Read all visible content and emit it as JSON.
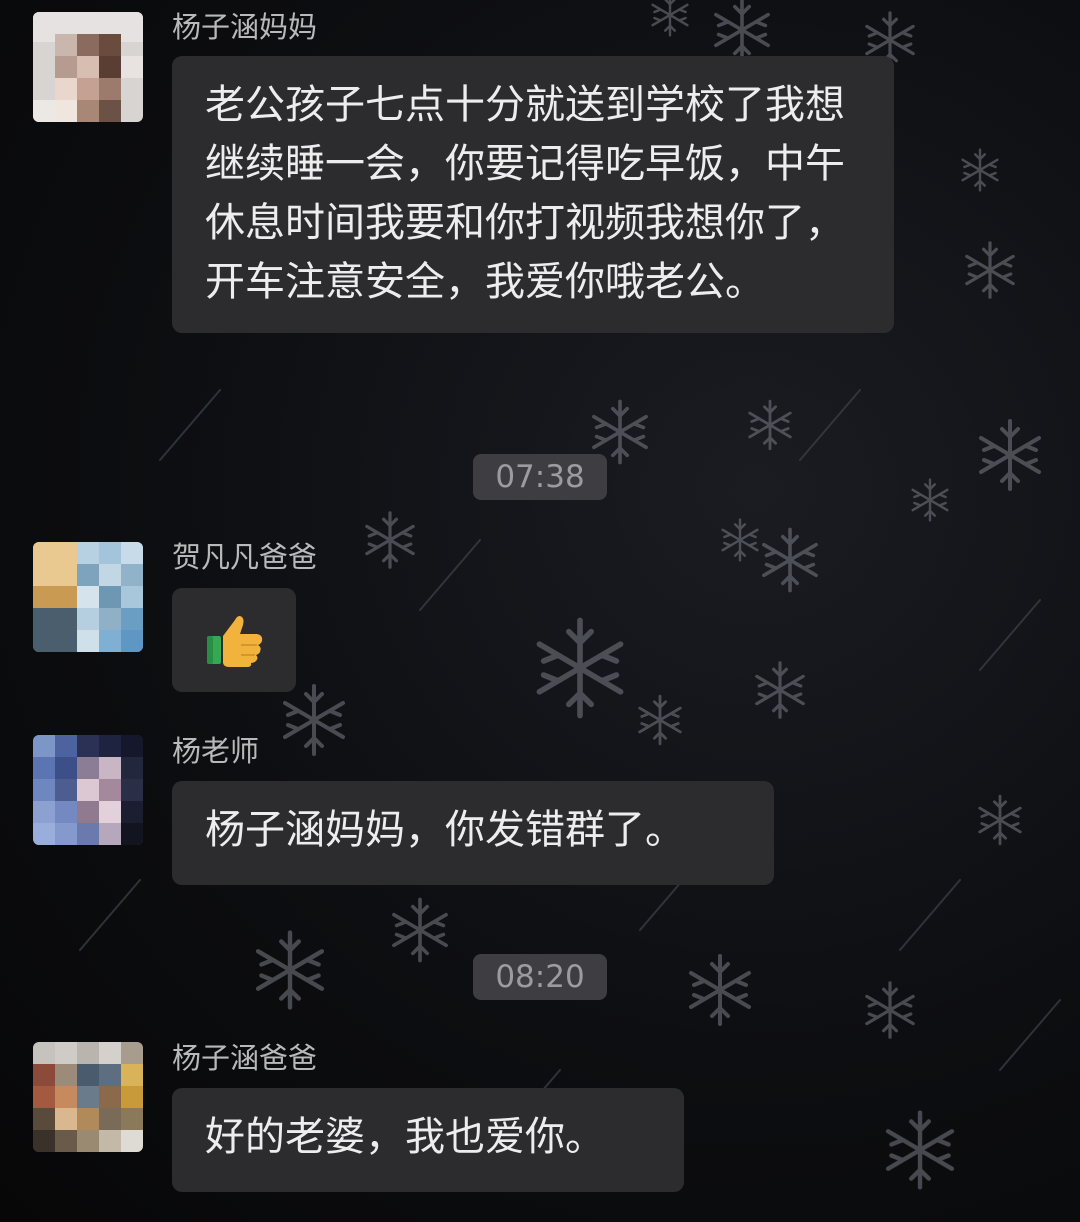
{
  "messages": [
    {
      "sender": "杨子涵妈妈",
      "text": "老公孩子七点十分就送到学校了我想继续睡一会，你要记得吃早饭，中午休息时间我要和你打视频我想你了，开车注意安全，我爱你哦老公。"
    },
    {
      "time": "07:38"
    },
    {
      "sender": "贺凡凡爸爸",
      "emoji": "👍",
      "emoji_icon": "thumbs-up-icon"
    },
    {
      "sender": "杨老师",
      "text": "杨子涵妈妈，你发错群了。"
    },
    {
      "time": "08:20"
    },
    {
      "sender": "杨子涵爸爸",
      "text": "好的老婆，我也爱你。"
    }
  ],
  "colors": {
    "background": "#0b0b0c",
    "bubble": "#2c2c2e",
    "bubble_text": "#ededed",
    "sender_text": "#b9b9bb",
    "timestamp_bg": "#3e3e42",
    "timestamp_text": "#9c9ca0",
    "thumb_yellow": "#f2b33d",
    "thumb_green": "#34a853"
  }
}
